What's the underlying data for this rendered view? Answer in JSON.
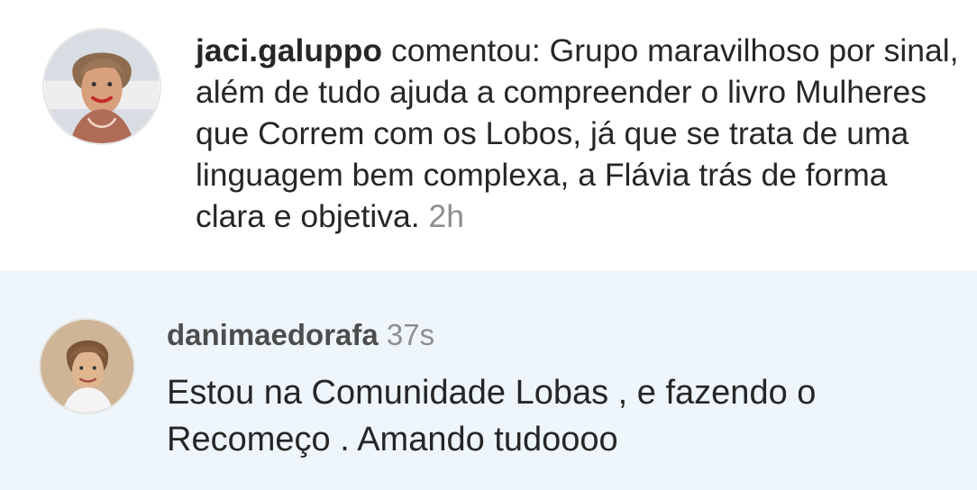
{
  "comment": {
    "username": "jaci.galuppo",
    "action": "comentou:",
    "text": "Grupo maravilhoso por sinal, além de tudo ajuda a compreender o livro Mulheres que Correm com os Lobos, já que se trata de uma linguagem bem complexa, a Flávia trás de forma clara e objetiva.",
    "time": "2h",
    "avatar_icon": "user-avatar-photo"
  },
  "reply": {
    "username": "danimaedorafa",
    "time": "37s",
    "text": "Estou na Comunidade Lobas , e fazendo o Recomeço . Amando tudoooo",
    "avatar_icon": "user-avatar-photo"
  },
  "colors": {
    "text_primary": "#262626",
    "text_secondary": "#8e8e8e",
    "reply_background": "#eef6fb"
  }
}
